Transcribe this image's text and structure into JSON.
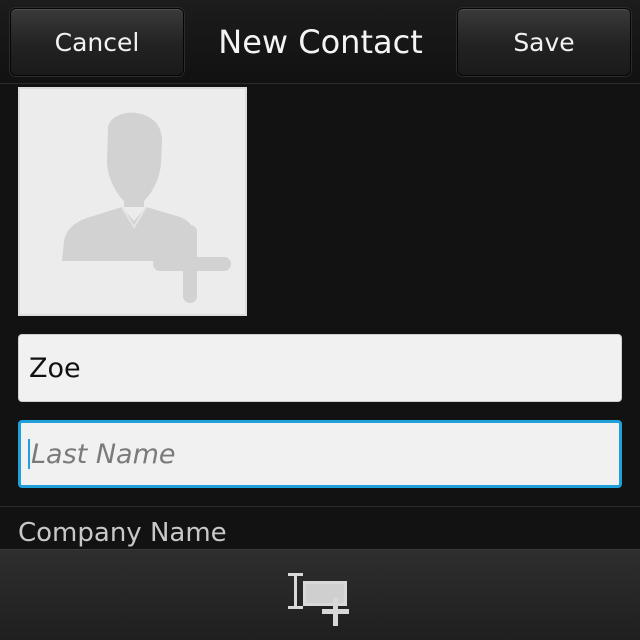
{
  "header": {
    "cancel_label": "Cancel",
    "title": "New Contact",
    "save_label": "Save"
  },
  "photo": {
    "icon": "add-person-photo-icon"
  },
  "fields": {
    "first_name_value": "Zoe",
    "last_name_placeholder": "Last Name",
    "company_label": "Company Name"
  },
  "actionbar": {
    "icon": "add-field-icon"
  },
  "colors": {
    "focus_accent": "#1fa0d8",
    "background": "#121212",
    "field_background": "#f1f1f1"
  }
}
